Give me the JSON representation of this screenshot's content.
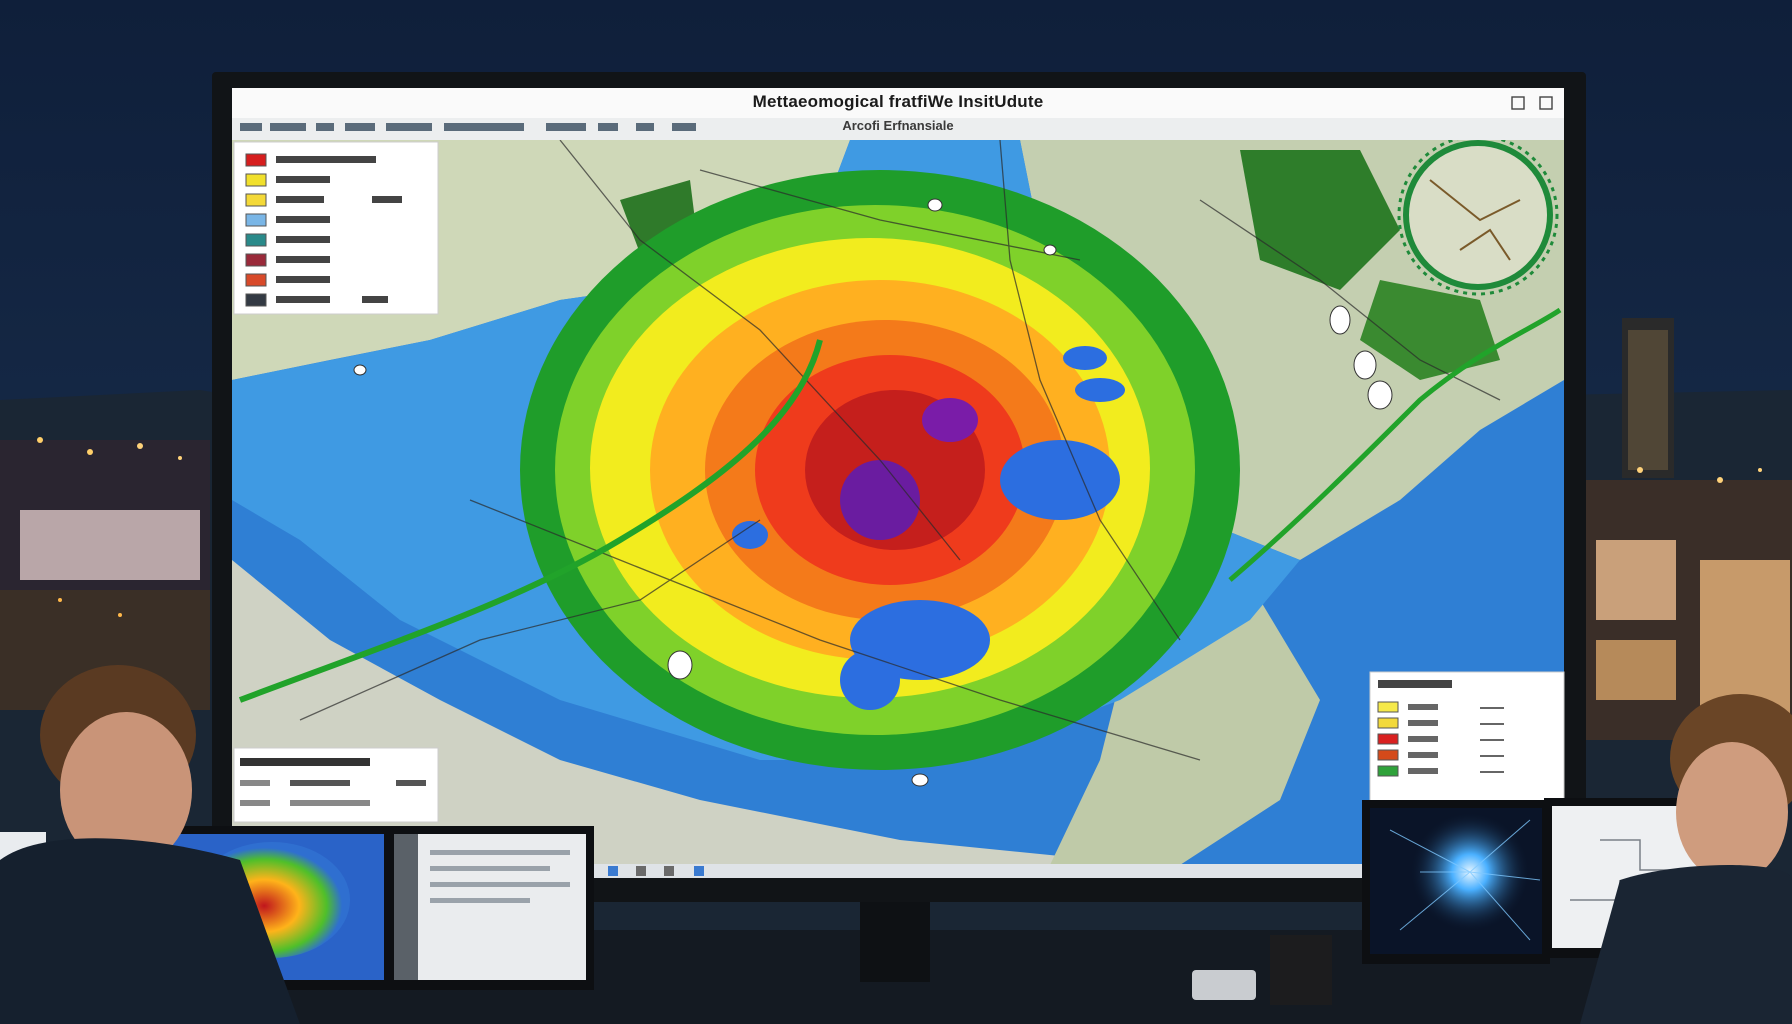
{
  "screen": {
    "title": "Mettaeomogical fratfiWe InsitUdute",
    "subtitle": "Arcofi Erfnansiale",
    "windowControls": [
      "close-icon",
      "minimize-icon"
    ]
  },
  "palette": {
    "sky": "#0f1f3a",
    "water": "#2f7fd4",
    "land": "#cfd8b8",
    "heatScale": [
      "#1f9d2a",
      "#7fd12a",
      "#f2ec1e",
      "#ff9f1a",
      "#ef3b1c",
      "#b1151e",
      "#5a1c9c"
    ]
  },
  "legendTopLeft": {
    "swatchColors": [
      "#d61f1f",
      "#f1e02c",
      "#f4d938",
      "#7ab6e6",
      "#2a8a8a",
      "#9a2a3a",
      "#d84a2a",
      "#333a44"
    ]
  },
  "legendBottomRight": {
    "swatchColors": [
      "#f5e94a",
      "#f2d93a",
      "#d92020",
      "#d44a1a",
      "#2fa23a"
    ]
  }
}
